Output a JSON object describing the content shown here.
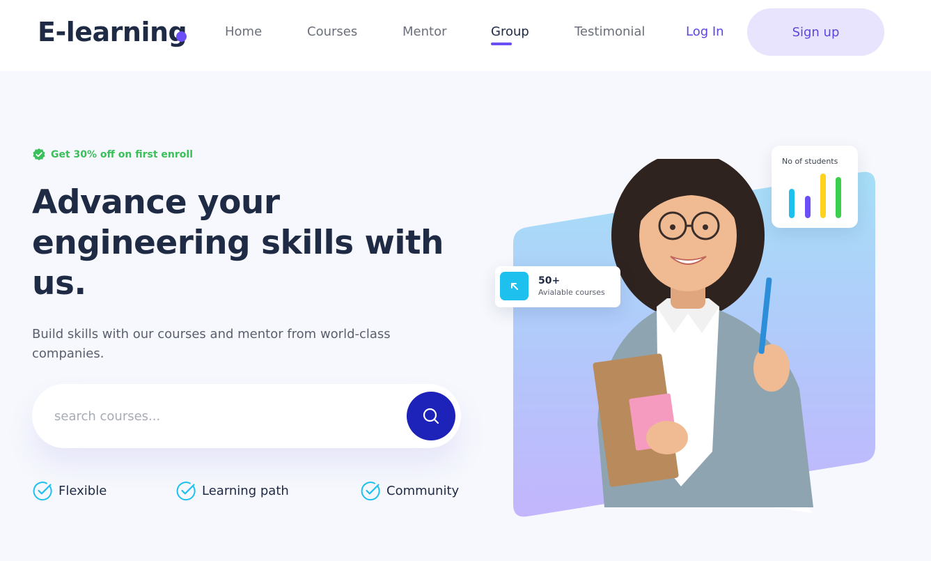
{
  "brand": {
    "name": "E-learning",
    "dot_color": "#6b4ef5"
  },
  "nav": {
    "items": [
      {
        "label": "Home",
        "active": false
      },
      {
        "label": "Courses",
        "active": false
      },
      {
        "label": "Mentor",
        "active": false
      },
      {
        "label": "Group",
        "active": true
      },
      {
        "label": "Testimonial",
        "active": false
      }
    ],
    "login_label": "Log In",
    "signup_label": "Sign up"
  },
  "hero": {
    "promo": "Get 30% off on first enroll",
    "headline_line1": "Advance your",
    "headline_line2": "engineering skills with",
    "headline_line3": "us.",
    "subtext": "Build skills with our courses and mentor from world-class companies."
  },
  "search": {
    "placeholder": "search courses...",
    "value": ""
  },
  "features": [
    {
      "label": "Flexible",
      "icon": "check-circle-icon"
    },
    {
      "label": "Learning path",
      "icon": "check-circle-icon"
    },
    {
      "label": "Community",
      "icon": "check-circle-icon"
    }
  ],
  "stats_card": {
    "value": "50+",
    "label": "Avialable courses",
    "icon": "arrow-up-left-icon"
  },
  "students_card": {
    "title": "No of students",
    "bar_colors": [
      "#1ec0ee",
      "#6b4ef5",
      "#ffd21f",
      "#3ccf4e"
    ]
  },
  "colors": {
    "accent": "#6b4ef5",
    "primary_dark": "#1d22b8",
    "promo_green": "#3bbf5a",
    "heading": "#1f2a44"
  }
}
